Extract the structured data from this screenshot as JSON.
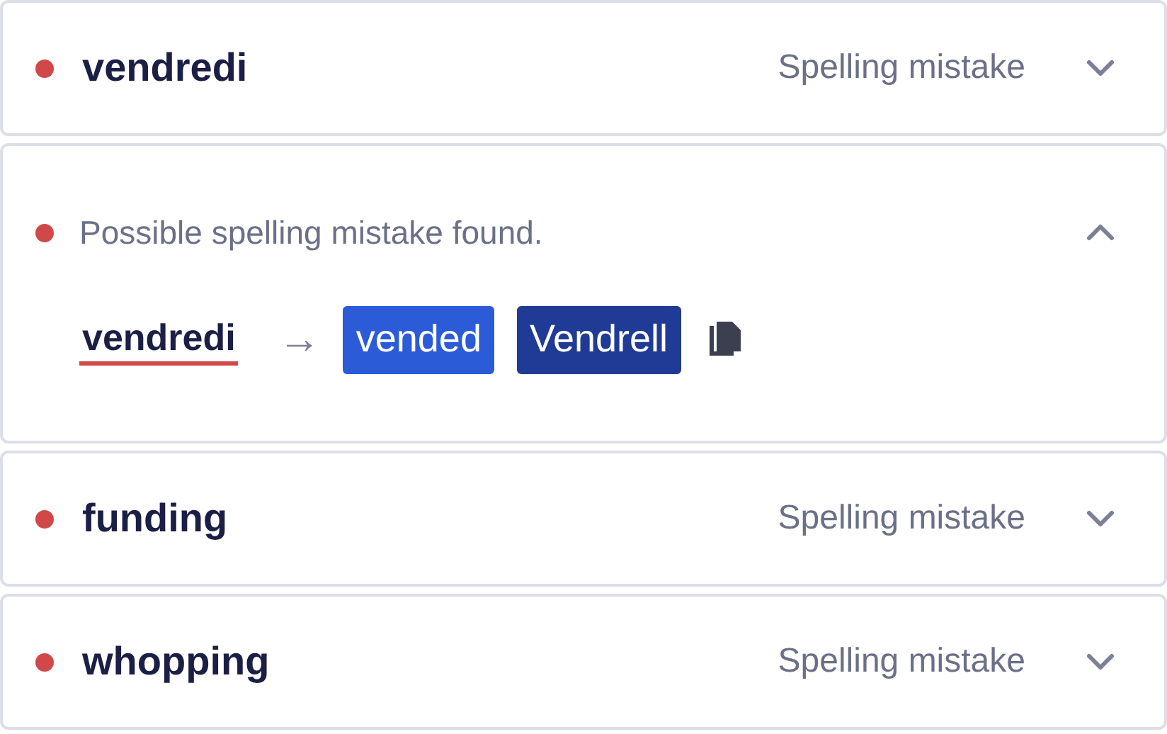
{
  "issues": [
    {
      "word": "vendredi",
      "category": "Spelling mistake",
      "expanded": false
    },
    {
      "word": "vendredi",
      "message": "Possible spelling mistake found.",
      "expanded": true,
      "arrow": "→",
      "suggestions": [
        {
          "text": "vended",
          "selected": false
        },
        {
          "text": "Vendrell",
          "selected": true
        }
      ]
    },
    {
      "word": "funding",
      "category": "Spelling mistake",
      "expanded": false
    },
    {
      "word": "whopping",
      "category": "Spelling mistake",
      "expanded": false
    }
  ]
}
